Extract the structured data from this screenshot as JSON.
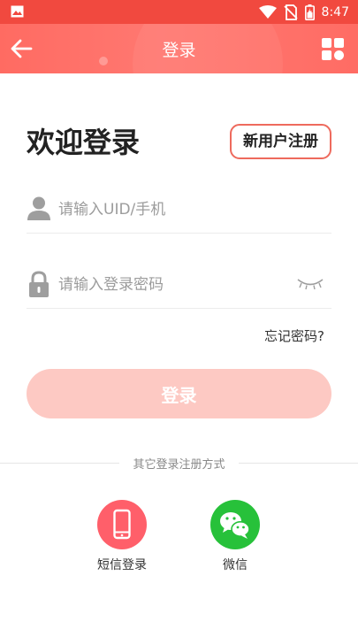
{
  "status_bar": {
    "time": "8:47",
    "icons": [
      "gallery-icon",
      "wifi-icon",
      "no-sim-icon",
      "battery-icon"
    ]
  },
  "app_bar": {
    "title": "登录",
    "back_icon": "arrow-left-icon",
    "menu_icon": "grid-icon"
  },
  "welcome": "欢迎登录",
  "register_button": "新用户注册",
  "uid_field": {
    "placeholder": "请输入UID/手机",
    "value": ""
  },
  "password_field": {
    "placeholder": "请输入登录密码",
    "value": ""
  },
  "forgot_password": "忘记密码?",
  "login_button": "登录",
  "other_methods": {
    "title": "其它登录注册方式",
    "sms": "短信登录",
    "wechat": "微信"
  },
  "colors": {
    "status_bar": "#f1493f",
    "app_bar": "#ff6f67",
    "login_button": "#fdc9c3",
    "register_border": "#ee6a5d",
    "sms": "#ff5f6a",
    "wechat": "#27c13a"
  }
}
